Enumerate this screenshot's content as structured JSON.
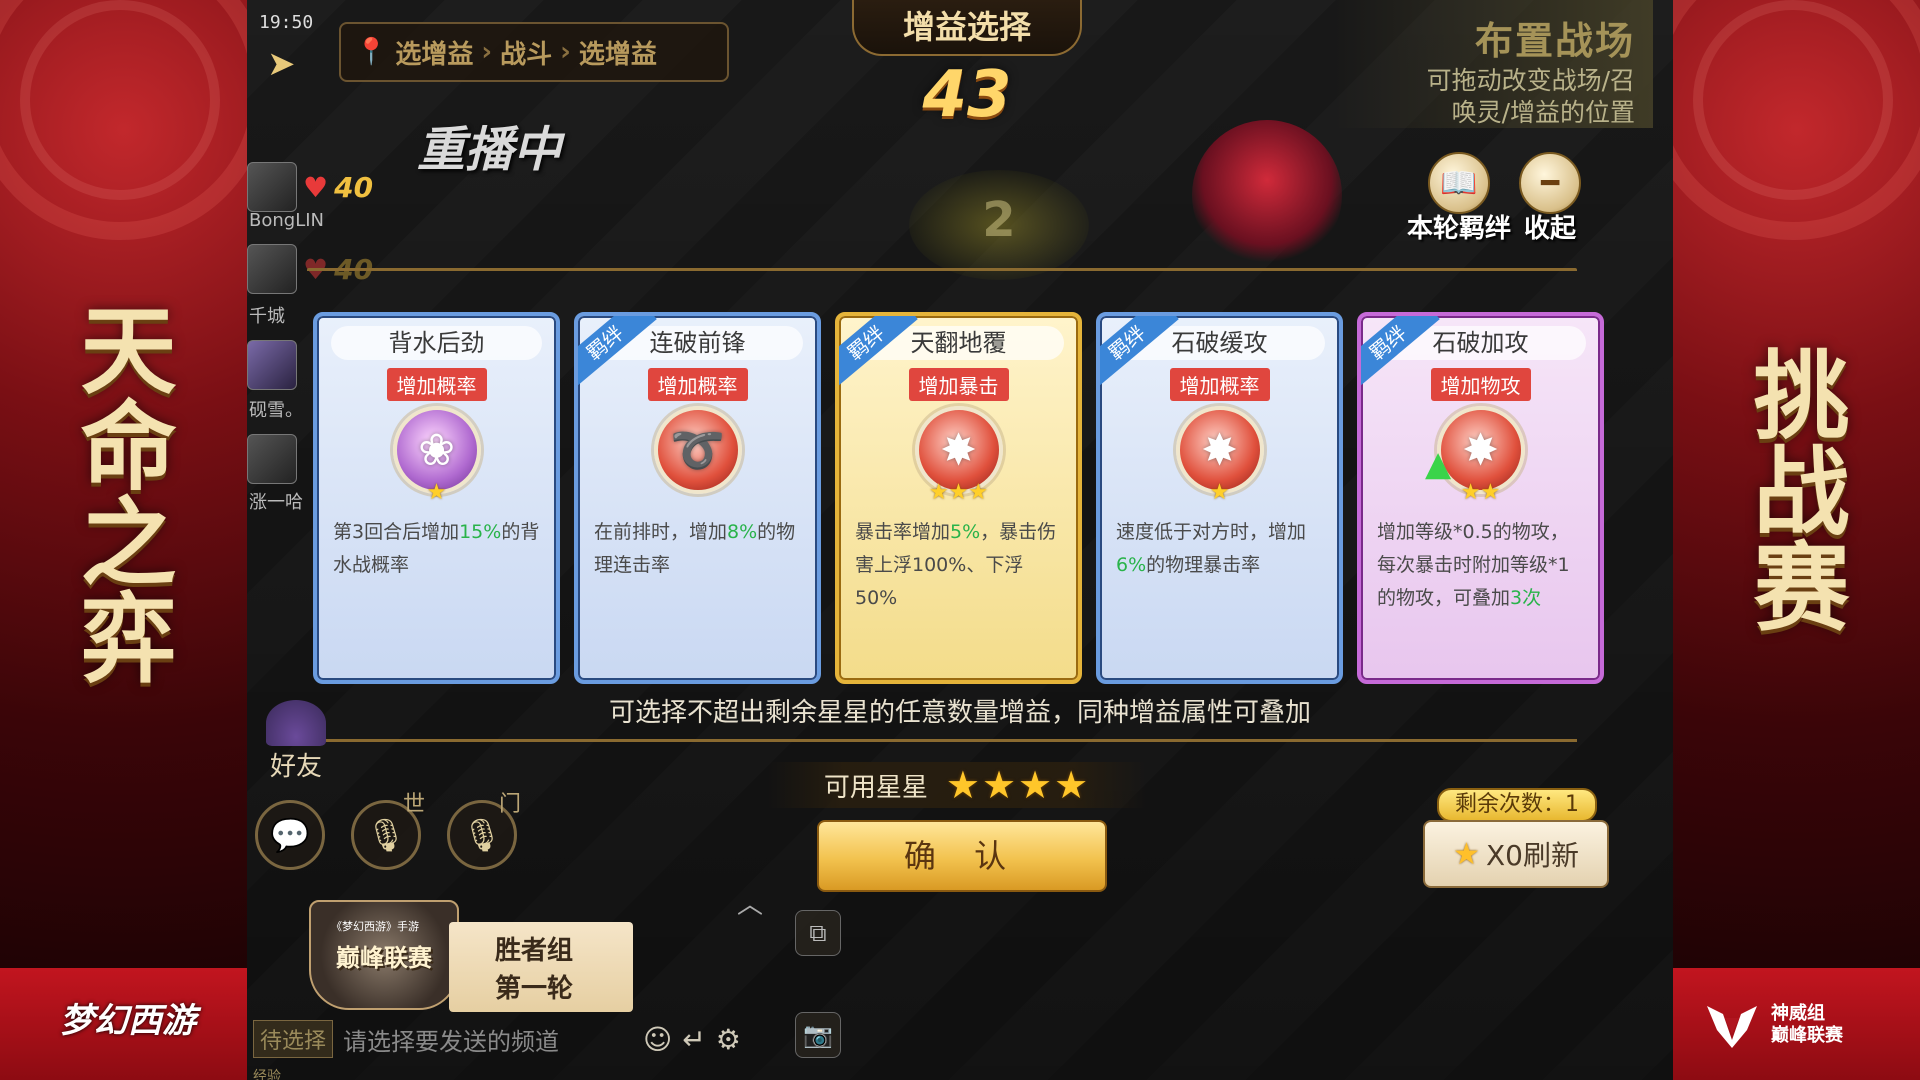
{
  "side_left": {
    "title": "天命之弈",
    "logo": "梦幻西游"
  },
  "side_right": {
    "title": "挑战赛",
    "logo_line1": "神威组",
    "logo_line2": "巅峰联赛"
  },
  "game": {
    "clock": "19:50",
    "breadcrumb": [
      "选增益",
      "战斗",
      "选增益"
    ],
    "replay": "重播中",
    "title": "增益选择",
    "countdown": "43",
    "arrange": {
      "title": "布置战场",
      "desc_line1": "可拖动改变战场/召",
      "desc_line2": "唤灵/增益的位置"
    },
    "round_bond": "本轮羁绊",
    "collapse": "收起",
    "board_number": "2",
    "players": [
      {
        "name": "BongLIN",
        "hp": "40"
      },
      {
        "name": "千城",
        "hp": "40"
      },
      {
        "name": "砚雪。",
        "hp": ""
      },
      {
        "name": "涨一哈",
        "hp": ""
      }
    ],
    "cards": [
      {
        "name": "背水后劲",
        "tag": "增加概率",
        "ribbon": "",
        "stars": "★",
        "desc_pre": "第3回合后增加",
        "desc_hl": "15%",
        "desc_post": "的背水战概率"
      },
      {
        "name": "连破前锋",
        "tag": "增加概率",
        "ribbon": "羁绊",
        "stars": "",
        "desc_pre": "在前排时，增加",
        "desc_hl": "8%",
        "desc_post": "的物理连击率"
      },
      {
        "name": "天翻地覆",
        "tag": "增加暴击",
        "ribbon": "羁绊",
        "stars": "★★★",
        "desc_pre": "暴击率增加",
        "desc_hl": "5%",
        "desc_post": "，暴击伤害上浮100%、下浮50%"
      },
      {
        "name": "石破缓攻",
        "tag": "增加概率",
        "ribbon": "羁绊",
        "stars": "★",
        "desc_pre": "速度低于对方时，增加",
        "desc_hl": "6%",
        "desc_post": "的物理暴击率"
      },
      {
        "name": "石破加攻",
        "tag": "增加物攻",
        "ribbon": "羁绊",
        "stars": "★★",
        "desc_pre": "增加等级*0.5的物攻，每次暴击时附加等级*1的物攻，可叠加",
        "desc_hl": "3次",
        "desc_post": ""
      }
    ],
    "tip": "可选择不超出剩余星星的任意数量增益，同种增益属性可叠加",
    "available_stars_label": "可用星星",
    "available_stars": "★★★★",
    "confirm": "确 认",
    "remaining": "剩余次数：1",
    "refresh": "X0刷新",
    "friend": "好友",
    "channel_world": "世",
    "channel_sect": "门",
    "promo": {
      "small": "《梦幻西游》手游",
      "emblem": "巅峰联赛",
      "line1": "胜者组",
      "line2": "第一轮"
    },
    "chat_status": "待选择",
    "chat_placeholder": "请选择要发送的频道",
    "exp": "经验"
  },
  "colors": {
    "accent_gold": "#f2c24e",
    "card_blue": "#6a9ce0",
    "card_gold": "#e5b43a",
    "card_purple": "#c66ad8",
    "highlight_green": "#29b34a"
  }
}
